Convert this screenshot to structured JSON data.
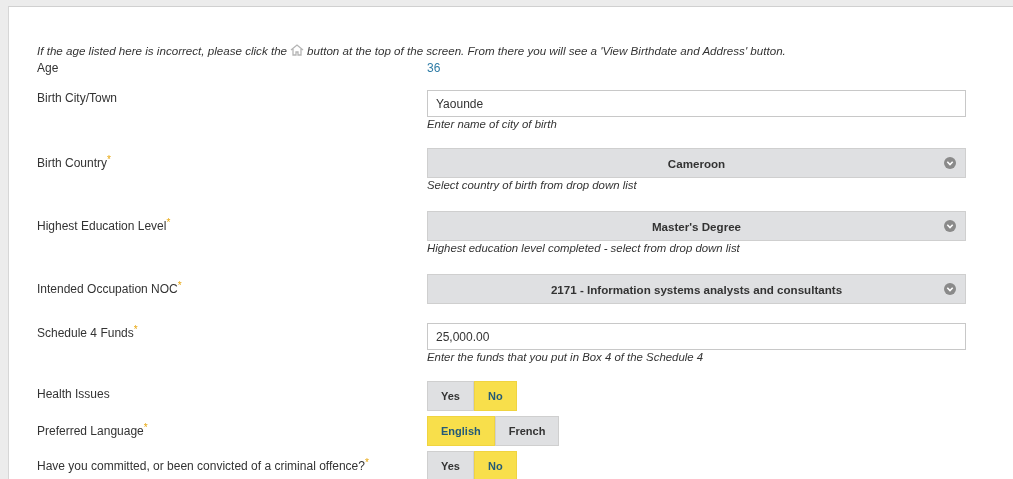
{
  "notice": {
    "before": "If the age listed here is incorrect, please click the",
    "after": "button at the top of the screen. From there you will see a 'View Birthdate and Address' button."
  },
  "fields": [
    {
      "kind": "value",
      "label": "Age",
      "value": "36"
    },
    {
      "kind": "text",
      "label": "Birth City/Town",
      "value": "Yaounde",
      "hint": "Enter name of city of birth"
    },
    {
      "kind": "select",
      "label": "Birth Country",
      "mark": "*",
      "value": "Cameroon",
      "hint": "Select country of birth from drop down list"
    },
    {
      "kind": "select",
      "label": "Highest Education Level",
      "mark": "*",
      "value": "Master's Degree",
      "hint": "Highest education level completed - select from drop down list"
    },
    {
      "kind": "select",
      "label": "Intended Occupation NOC",
      "mark": "*",
      "value": "2171 - Information systems analysts and consultants"
    },
    {
      "kind": "text",
      "label": "Schedule 4 Funds",
      "mark": "*",
      "value": "25,000.00",
      "hint": "Enter the funds that you put in Box 4 of the Schedule 4"
    },
    {
      "kind": "toggle",
      "label": "Health Issues",
      "options": [
        {
          "label": "Yes",
          "selected": false
        },
        {
          "label": "No",
          "selected": true
        }
      ]
    },
    {
      "kind": "toggle",
      "label": "Preferred Language",
      "mark": "*",
      "options": [
        {
          "label": "English",
          "selected": true
        },
        {
          "label": "French",
          "selected": false
        }
      ]
    },
    {
      "kind": "toggle",
      "label": "Have you committed, or been convicted of a criminal offence?",
      "mark": "*",
      "options": [
        {
          "label": "Yes",
          "selected": false
        },
        {
          "label": "No",
          "selected": true
        }
      ]
    }
  ]
}
